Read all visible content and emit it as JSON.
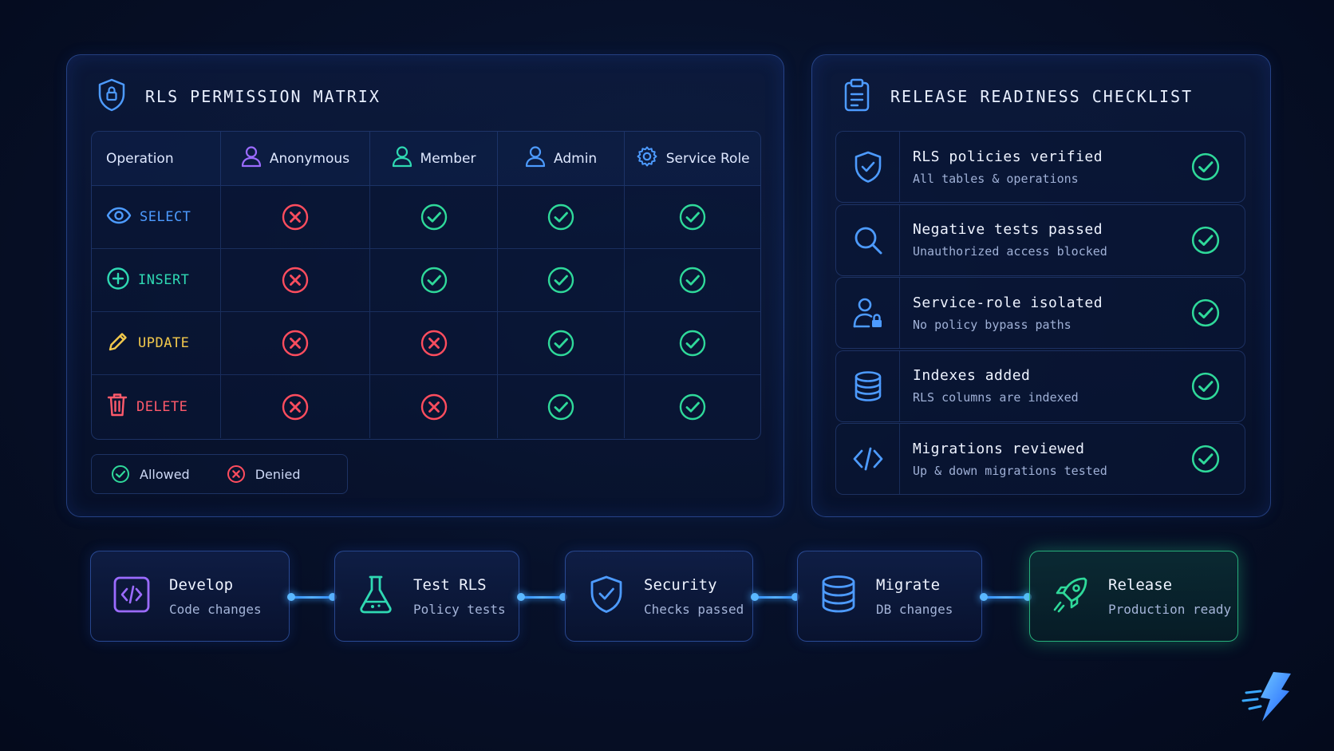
{
  "matrix": {
    "title": "RLS PERMISSION MATRIX",
    "columns": [
      "Operation",
      "Anonymous",
      "Member",
      "Admin",
      "Service Role"
    ],
    "rows": [
      {
        "operation": "SELECT",
        "anonymous": "denied",
        "member": "allowed",
        "admin": "allowed",
        "service_role": "allowed"
      },
      {
        "operation": "INSERT",
        "anonymous": "denied",
        "member": "allowed",
        "admin": "allowed",
        "service_role": "allowed"
      },
      {
        "operation": "UPDATE",
        "anonymous": "denied",
        "member": "denied",
        "admin": "allowed",
        "service_role": "allowed"
      },
      {
        "operation": "DELETE",
        "anonymous": "denied",
        "member": "denied",
        "admin": "allowed",
        "service_role": "allowed"
      }
    ],
    "legend": {
      "allowed": "Allowed",
      "denied": "Denied"
    }
  },
  "checklist": {
    "title": "RELEASE READINESS CHECKLIST",
    "items": [
      {
        "title": "RLS policies verified",
        "subtitle": "All tables & operations",
        "icon": "shield-check-icon",
        "status": "done"
      },
      {
        "title": "Negative tests passed",
        "subtitle": "Unauthorized access blocked",
        "icon": "search-icon",
        "status": "done"
      },
      {
        "title": "Service-role isolated",
        "subtitle": "No policy bypass paths",
        "icon": "user-lock-icon",
        "status": "done"
      },
      {
        "title": "Indexes added",
        "subtitle": "RLS columns are indexed",
        "icon": "database-icon",
        "status": "done"
      },
      {
        "title": "Migrations reviewed",
        "subtitle": "Up & down migrations tested",
        "icon": "code-icon",
        "status": "done"
      }
    ]
  },
  "pipeline": [
    {
      "title": "Develop",
      "subtitle": "Code changes",
      "icon": "code-icon"
    },
    {
      "title": "Test RLS",
      "subtitle": "Policy tests",
      "icon": "flask-icon"
    },
    {
      "title": "Security",
      "subtitle": "Checks passed",
      "icon": "shield-check-icon"
    },
    {
      "title": "Migrate",
      "subtitle": "DB changes",
      "icon": "database-icon"
    },
    {
      "title": "Release",
      "subtitle": "Production ready",
      "icon": "rocket-icon"
    }
  ],
  "colors": {
    "allowed": "#2fd99a",
    "denied": "#ff4d5e",
    "select": "#4d9bff",
    "insert": "#2fd9b3",
    "update": "#f2c94c",
    "delete": "#ff5a6b",
    "accent": "#3a9cff"
  }
}
